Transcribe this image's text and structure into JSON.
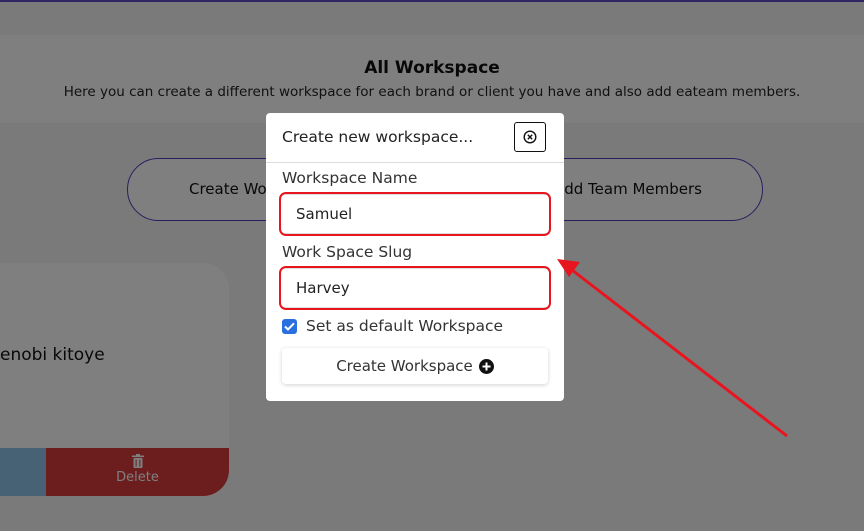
{
  "header": {
    "title": "All Workspace",
    "subtitle": "Here you can create a different workspace for each brand or client you have and also add eateam members."
  },
  "actions": {
    "create_label": "Create Wo",
    "add_members_label": "dd Team Members"
  },
  "card": {
    "name": "enobi kitoye",
    "delete_label": "Delete"
  },
  "modal": {
    "title": "Create new workspace...",
    "workspace_name_label": "Workspace Name",
    "workspace_name_value": "Samuel",
    "slug_label": "Work Space Slug",
    "slug_value": "Harvey",
    "default_checkbox_label": "Set as default Workspace",
    "default_checked": true,
    "create_button_label": "Create Workspace"
  },
  "colors": {
    "accent": "#4a3fc0",
    "highlight": "#e8141e",
    "checkbox": "#2a6fe0",
    "delete": "#d83c3c"
  }
}
